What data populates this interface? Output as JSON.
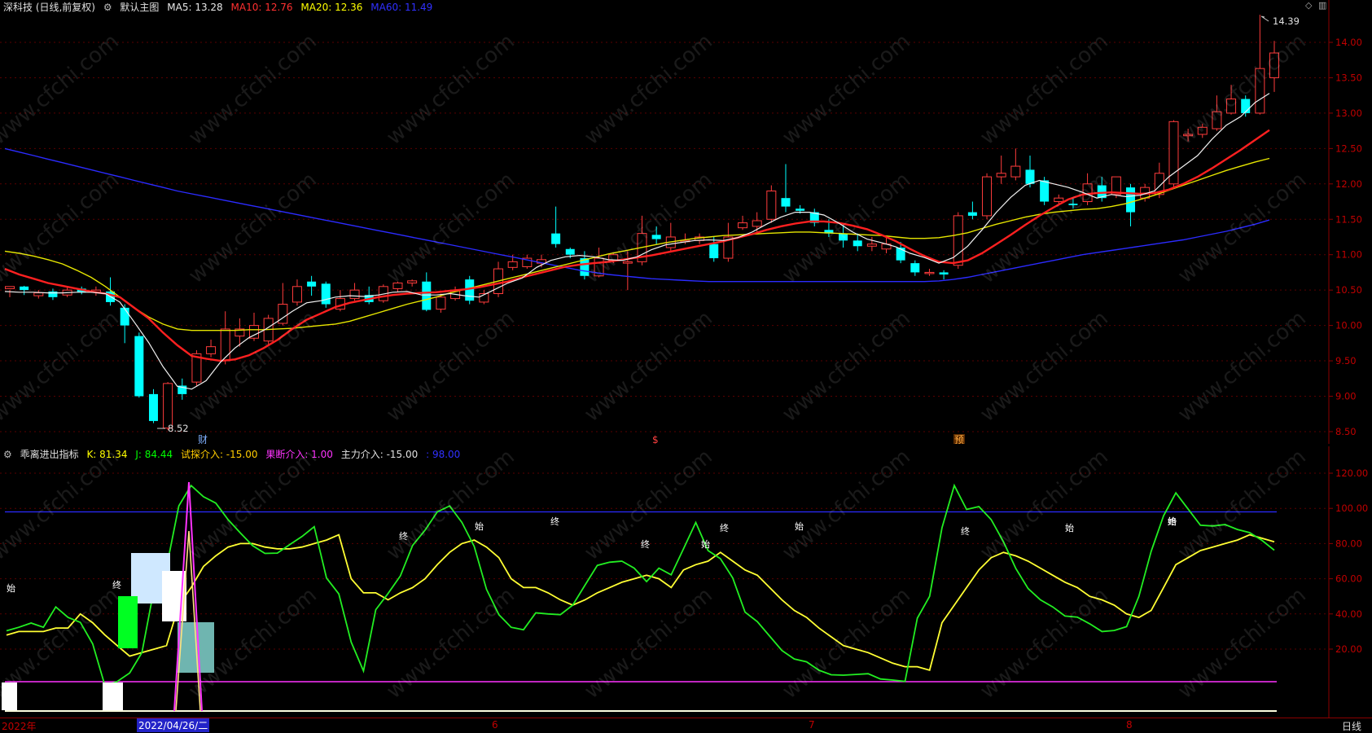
{
  "main_header": {
    "title": "深科技 (日线,前复权)",
    "indicator_name": "默认主图",
    "ma5": "MA5: 13.28",
    "ma10": "MA10: 12.76",
    "ma20": "MA20: 12.36",
    "ma60": "MA60: 11.49",
    "colors": {
      "ma5": "#e8e8e8",
      "ma10": "#ff3030",
      "ma20": "#ffff00",
      "ma60": "#3030ff"
    }
  },
  "sub_header": {
    "name": "乖离进出指标",
    "k": "K: 81.34",
    "j": "J: 84.44",
    "try": "试探介入: -15.00",
    "decisive": "果断介入: 1.00",
    "main": "主力介入: -15.00",
    "tail": ": 98.00"
  },
  "price_axis": [
    "14.00",
    "13.50",
    "13.00",
    "12.50",
    "12.00",
    "11.50",
    "11.00",
    "10.50",
    "10.00",
    "9.50",
    "9.00",
    "8.50"
  ],
  "osc_axis": [
    "120.00",
    "100.00",
    "80.00",
    "60.00",
    "40.00",
    "20.00"
  ],
  "annotations": {
    "high": "14.39",
    "low": "8.52",
    "marker_cai": "财",
    "marker_s": "$",
    "marker_yu": "预"
  },
  "date_axis": {
    "year": "2022年",
    "cursor": "2022/04/26/二",
    "m6": "6",
    "m7": "7",
    "m8": "8",
    "period": "日线"
  },
  "osc_labels": [
    "始",
    "终",
    "终",
    "始",
    "终",
    "终",
    "始",
    "终",
    "始",
    "终",
    "始",
    "终",
    "始"
  ],
  "watermark": "www.cfchi.com",
  "chart_data": {
    "type": "candlestick",
    "ylim": [
      8.4,
      14.4
    ],
    "candles": [
      [
        10.52,
        10.55,
        10.4,
        10.5
      ],
      [
        10.55,
        10.5,
        10.43,
        10.56
      ],
      [
        10.42,
        10.46,
        10.38,
        10.5
      ],
      [
        10.48,
        10.4,
        10.36,
        10.52
      ],
      [
        10.43,
        10.5,
        10.4,
        10.55
      ],
      [
        10.52,
        10.47,
        10.44,
        10.55
      ],
      [
        10.47,
        10.5,
        10.42,
        10.55
      ],
      [
        10.48,
        10.33,
        10.28,
        10.68
      ],
      [
        10.25,
        10.0,
        9.75,
        10.3
      ],
      [
        9.85,
        9.0,
        8.98,
        9.9
      ],
      [
        9.03,
        8.65,
        8.62,
        9.1
      ],
      [
        8.55,
        9.18,
        8.52,
        9.2
      ],
      [
        9.15,
        9.03,
        8.95,
        9.25
      ],
      [
        9.2,
        9.6,
        9.15,
        9.65
      ],
      [
        9.6,
        9.7,
        9.55,
        9.8
      ],
      [
        9.5,
        9.95,
        9.45,
        10.2
      ],
      [
        9.85,
        9.95,
        9.7,
        10.1
      ],
      [
        9.82,
        10.0,
        9.78,
        10.18
      ],
      [
        9.78,
        10.1,
        9.72,
        10.15
      ],
      [
        10.03,
        10.3,
        10.0,
        10.6
      ],
      [
        10.33,
        10.55,
        10.28,
        10.65
      ],
      [
        10.62,
        10.55,
        10.42,
        10.7
      ],
      [
        10.59,
        10.3,
        10.25,
        10.62
      ],
      [
        10.23,
        10.38,
        10.2,
        10.5
      ],
      [
        10.38,
        10.5,
        10.35,
        10.6
      ],
      [
        10.43,
        10.33,
        10.3,
        10.55
      ],
      [
        10.35,
        10.55,
        10.32,
        10.58
      ],
      [
        10.52,
        10.6,
        10.47,
        10.62
      ],
      [
        10.6,
        10.63,
        10.55,
        10.65
      ],
      [
        10.62,
        10.22,
        10.2,
        10.75
      ],
      [
        10.23,
        10.4,
        10.18,
        10.45
      ],
      [
        10.38,
        10.5,
        10.35,
        10.55
      ],
      [
        10.65,
        10.35,
        10.3,
        10.7
      ],
      [
        10.33,
        10.45,
        10.3,
        10.5
      ],
      [
        10.45,
        10.8,
        10.4,
        10.9
      ],
      [
        10.82,
        10.9,
        10.78,
        11.0
      ],
      [
        10.83,
        10.95,
        10.8,
        11.0
      ],
      [
        10.88,
        10.93,
        10.82,
        11.0
      ],
      [
        11.3,
        11.15,
        11.1,
        11.68
      ],
      [
        11.08,
        11.0,
        10.95,
        11.1
      ],
      [
        10.95,
        10.7,
        10.65,
        11.05
      ],
      [
        10.7,
        10.95,
        10.68,
        11.1
      ],
      [
        10.92,
        11.0,
        10.88,
        11.02
      ],
      [
        10.88,
        10.9,
        10.5,
        11.05
      ],
      [
        10.9,
        11.3,
        10.85,
        11.55
      ],
      [
        11.28,
        11.22,
        11.15,
        11.4
      ],
      [
        11.1,
        11.25,
        11.05,
        11.45
      ],
      [
        11.2,
        11.2,
        11.15,
        11.3
      ],
      [
        11.2,
        11.25,
        11.15,
        11.3
      ],
      [
        11.15,
        10.95,
        10.9,
        11.25
      ],
      [
        10.95,
        11.25,
        10.9,
        11.45
      ],
      [
        11.38,
        11.45,
        11.35,
        11.55
      ],
      [
        11.4,
        11.48,
        11.3,
        11.6
      ],
      [
        11.5,
        11.9,
        11.45,
        11.98
      ],
      [
        11.8,
        11.68,
        11.6,
        12.28
      ],
      [
        11.65,
        11.62,
        11.58,
        11.7
      ],
      [
        11.6,
        11.45,
        11.4,
        11.65
      ],
      [
        11.35,
        11.3,
        11.25,
        11.5
      ],
      [
        11.3,
        11.2,
        11.1,
        11.45
      ],
      [
        11.2,
        11.12,
        11.05,
        11.3
      ],
      [
        11.12,
        11.15,
        11.05,
        11.25
      ],
      [
        11.08,
        11.15,
        11.02,
        11.25
      ],
      [
        11.1,
        10.92,
        10.88,
        11.18
      ],
      [
        10.88,
        10.75,
        10.7,
        10.92
      ],
      [
        10.75,
        10.75,
        10.7,
        10.8
      ],
      [
        10.75,
        10.72,
        10.65,
        10.78
      ],
      [
        10.85,
        11.55,
        10.8,
        11.6
      ],
      [
        11.6,
        11.55,
        11.5,
        11.75
      ],
      [
        11.55,
        12.1,
        11.5,
        12.15
      ],
      [
        12.1,
        12.15,
        12.0,
        12.4
      ],
      [
        12.1,
        12.25,
        12.05,
        12.5
      ],
      [
        12.2,
        12.0,
        11.95,
        12.4
      ],
      [
        12.05,
        11.75,
        11.7,
        12.1
      ],
      [
        11.75,
        11.8,
        11.72,
        11.85
      ],
      [
        11.72,
        11.7,
        11.65,
        11.8
      ],
      [
        11.75,
        12.0,
        11.7,
        12.15
      ],
      [
        11.98,
        11.8,
        11.75,
        12.1
      ],
      [
        11.85,
        12.1,
        11.8,
        12.1
      ],
      [
        11.95,
        11.6,
        11.4,
        12.0
      ],
      [
        11.8,
        11.95,
        11.75,
        12.0
      ],
      [
        11.85,
        12.15,
        11.8,
        12.3
      ],
      [
        12.0,
        12.88,
        11.95,
        12.9
      ],
      [
        12.68,
        12.7,
        12.6,
        12.78
      ],
      [
        12.7,
        12.8,
        12.65,
        12.85
      ],
      [
        12.78,
        13.02,
        12.75,
        13.25
      ],
      [
        13.0,
        13.2,
        12.98,
        13.4
      ],
      [
        13.2,
        13.0,
        12.95,
        13.25
      ],
      [
        13.0,
        13.63,
        12.98,
        14.39
      ],
      [
        13.5,
        13.85,
        13.3,
        14.02
      ]
    ],
    "ma5": [
      10.48,
      10.47,
      10.47,
      10.46,
      10.46,
      10.47,
      10.47,
      10.45,
      10.33,
      10.05,
      9.76,
      9.42,
      9.14,
      9.1,
      9.22,
      9.48,
      9.68,
      9.83,
      9.93,
      10.06,
      10.2,
      10.32,
      10.35,
      10.4,
      10.42,
      10.41,
      10.43,
      10.47,
      10.48,
      10.43,
      10.43,
      10.45,
      10.42,
      10.4,
      10.5,
      10.6,
      10.67,
      10.82,
      10.92,
      10.97,
      10.99,
      10.97,
      10.93,
      10.92,
      10.97,
      11.07,
      11.14,
      11.17,
      11.2,
      11.21,
      11.2,
      11.24,
      11.32,
      11.43,
      11.53,
      11.6,
      11.6,
      11.56,
      11.45,
      11.32,
      11.22,
      11.17,
      11.11,
      11.02,
      10.96,
      10.88,
      10.96,
      11.12,
      11.35,
      11.6,
      11.81,
      11.98,
      12.05,
      12.0,
      11.95,
      11.88,
      11.8,
      11.85,
      11.82,
      11.84,
      11.9,
      12.1,
      12.25,
      12.4,
      12.63,
      12.83,
      12.95,
      13.15,
      13.28
    ],
    "ma10": [
      10.8,
      10.72,
      10.66,
      10.6,
      10.56,
      10.52,
      10.48,
      10.45,
      10.4,
      10.25,
      10.1,
      9.9,
      9.72,
      9.57,
      9.53,
      9.5,
      9.52,
      9.58,
      9.68,
      9.8,
      9.95,
      10.08,
      10.17,
      10.26,
      10.32,
      10.36,
      10.4,
      10.43,
      10.45,
      10.46,
      10.47,
      10.49,
      10.51,
      10.54,
      10.58,
      10.62,
      10.68,
      10.73,
      10.78,
      10.83,
      10.86,
      10.88,
      10.9,
      10.93,
      10.96,
      10.99,
      11.03,
      11.07,
      11.11,
      11.15,
      11.19,
      11.24,
      11.29,
      11.35,
      11.4,
      11.44,
      11.47,
      11.47,
      11.45,
      11.41,
      11.36,
      11.28,
      11.19,
      11.08,
      10.98,
      10.9,
      10.88,
      10.92,
      11.02,
      11.15,
      11.28,
      11.42,
      11.55,
      11.67,
      11.78,
      11.85,
      11.87,
      11.88,
      11.87,
      11.86,
      11.87,
      11.92,
      12.0,
      12.1,
      12.22,
      12.35,
      12.48,
      12.62,
      12.76
    ],
    "ma20": [
      11.05,
      11.02,
      10.98,
      10.93,
      10.87,
      10.78,
      10.68,
      10.55,
      10.4,
      10.25,
      10.12,
      10.02,
      9.95,
      9.93,
      9.93,
      9.93,
      9.93,
      9.94,
      9.94,
      9.95,
      9.96,
      9.98,
      10.0,
      10.02,
      10.06,
      10.12,
      10.18,
      10.24,
      10.3,
      10.35,
      10.4,
      10.46,
      10.51,
      10.56,
      10.61,
      10.66,
      10.71,
      10.76,
      10.81,
      10.86,
      10.91,
      10.96,
      11.01,
      11.05,
      11.09,
      11.13,
      11.17,
      11.2,
      11.23,
      11.25,
      11.27,
      11.28,
      11.29,
      11.3,
      11.31,
      11.32,
      11.32,
      11.31,
      11.3,
      11.29,
      11.28,
      11.27,
      11.25,
      11.23,
      11.23,
      11.24,
      11.27,
      11.31,
      11.37,
      11.43,
      11.48,
      11.53,
      11.57,
      11.6,
      11.62,
      11.64,
      11.65,
      11.68,
      11.72,
      11.78,
      11.84,
      11.91,
      11.98,
      12.05,
      12.12,
      12.19,
      12.25,
      12.31,
      12.36
    ],
    "ma60": [
      12.5,
      12.45,
      12.4,
      12.35,
      12.3,
      12.25,
      12.2,
      12.15,
      12.1,
      12.05,
      12.0,
      11.95,
      11.9,
      11.86,
      11.82,
      11.78,
      11.74,
      11.7,
      11.66,
      11.62,
      11.58,
      11.54,
      11.5,
      11.46,
      11.42,
      11.38,
      11.34,
      11.3,
      11.26,
      11.22,
      11.18,
      11.14,
      11.1,
      11.06,
      11.02,
      10.98,
      10.94,
      10.9,
      10.86,
      10.82,
      10.78,
      10.75,
      10.72,
      10.7,
      10.68,
      10.66,
      10.65,
      10.64,
      10.63,
      10.62,
      10.62,
      10.62,
      10.62,
      10.62,
      10.62,
      10.62,
      10.62,
      10.62,
      10.62,
      10.62,
      10.62,
      10.62,
      10.62,
      10.62,
      10.62,
      10.63,
      10.65,
      10.68,
      10.72,
      10.76,
      10.8,
      10.84,
      10.88,
      10.92,
      10.96,
      11.0,
      11.03,
      11.06,
      11.09,
      11.12,
      11.15,
      11.18,
      11.21,
      11.25,
      11.29,
      11.33,
      11.38,
      11.43,
      11.49
    ],
    "osc_k": [
      28,
      30,
      30,
      30,
      32,
      32,
      40,
      35,
      28,
      22,
      16,
      18,
      20,
      22,
      45,
      55,
      67,
      73,
      78,
      80,
      80,
      78,
      77,
      77,
      78,
      80,
      82,
      85,
      60,
      52,
      52,
      48,
      52,
      55,
      60,
      68,
      75,
      80,
      82,
      78,
      72,
      60,
      55,
      55,
      52,
      48,
      45,
      48,
      52,
      55,
      58,
      60,
      62,
      60,
      55,
      65,
      68,
      70,
      75,
      70,
      65,
      62,
      55,
      48,
      42,
      38,
      32,
      27,
      22,
      20,
      18,
      15,
      12,
      10,
      10,
      8,
      35,
      45,
      55,
      65,
      72,
      75,
      73,
      70,
      66,
      62,
      58,
      55,
      50,
      48,
      45,
      40,
      38,
      42,
      55,
      68,
      72,
      76,
      78,
      80,
      82,
      85,
      83,
      81
    ]
  }
}
